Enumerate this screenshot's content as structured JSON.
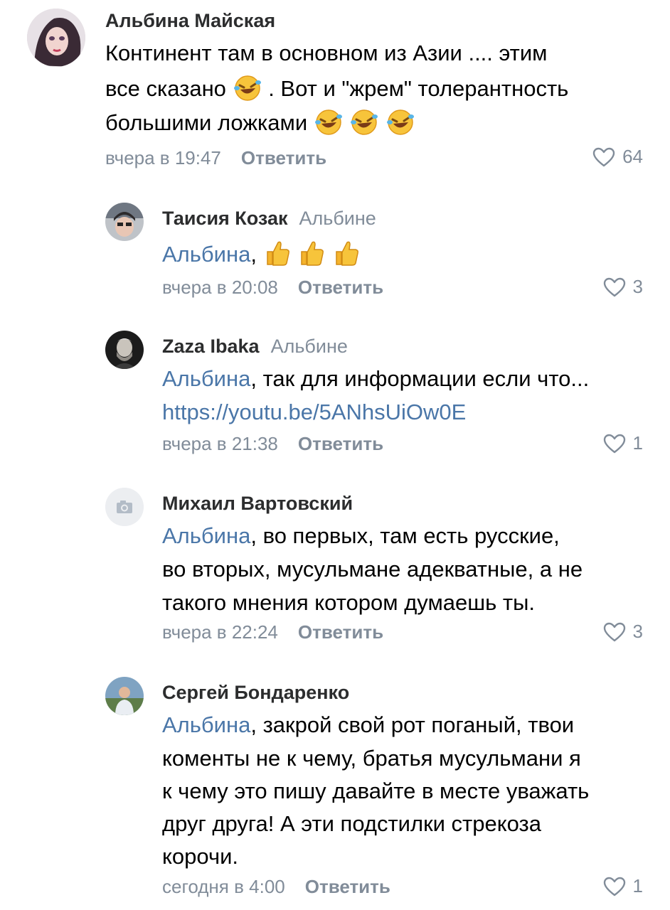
{
  "comments": [
    {
      "author": "Альбина Майская",
      "lines": [
        "Континент там в основном из Азии .... этим",
        "все сказано",
        ". Вот и \"жрем\" толерантность",
        "большими ложками"
      ],
      "time": "вчера в 19:47",
      "reply_label": "Ответить",
      "likes": "64"
    },
    {
      "author": "Таисия Козак",
      "reply_to": "Альбине",
      "mention": "Альбина",
      "text_after_mention": ",",
      "time": "вчера в 20:08",
      "reply_label": "Ответить",
      "likes": "3"
    },
    {
      "author": "Zaza Ibaka",
      "reply_to": "Альбине",
      "mention": "Альбина",
      "text_after_mention": ", так для информации если что...",
      "link": "https://youtu.be/5ANhsUiOw0E",
      "time": "вчера в 21:38",
      "reply_label": "Ответить",
      "likes": "1"
    },
    {
      "author": "Михаил Вартовский",
      "mention": "Альбина",
      "lines": [
        ", во первых, там есть русские,",
        "во вторых, мусульмане адекватные, а не",
        "такого мнения котором думаешь ты."
      ],
      "time": "вчера в 22:24",
      "reply_label": "Ответить",
      "likes": "3"
    },
    {
      "author": "Сергей Бондаренко",
      "mention": "Альбина",
      "lines": [
        ", закрой свой рот поганый, твои",
        "коменты не к чему, братья мусульмани я",
        "к чему это пишу давайте в месте уважать",
        "друг друга! А эти подстилки стрекоза",
        "корочи."
      ],
      "time": "сегодня в 4:00",
      "reply_label": "Ответить",
      "likes": "1"
    }
  ],
  "icons": {
    "laugh_emoji": "rolling-on-floor-laughing",
    "thumbs_emoji": "thumbs-up",
    "heart": "heart-outline",
    "camera": "camera-placeholder"
  },
  "colors": {
    "mention": "#4a76a8",
    "meta": "#818c99",
    "text": "#000000"
  }
}
